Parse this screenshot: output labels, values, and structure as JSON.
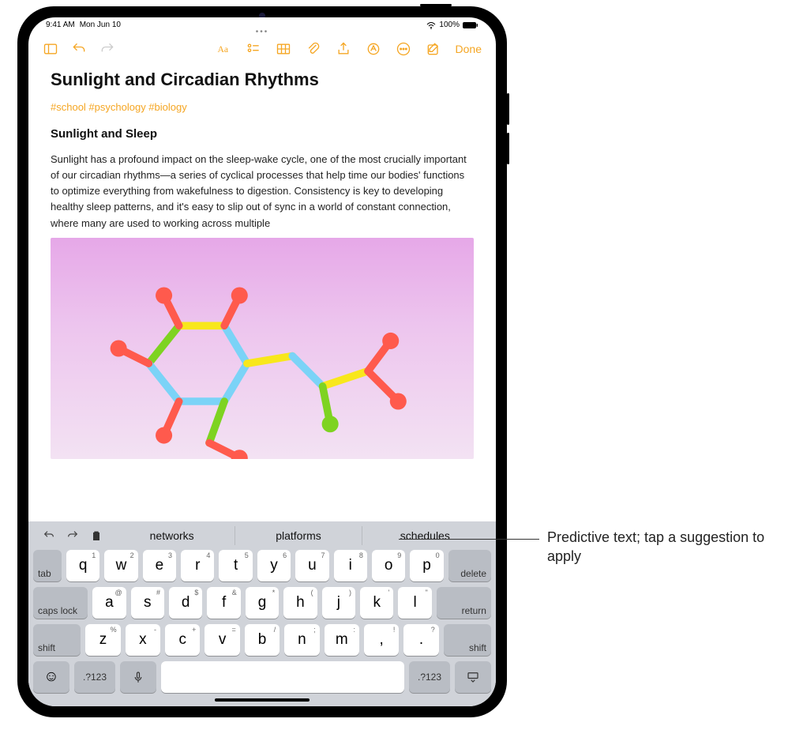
{
  "status": {
    "time": "9:41 AM",
    "date": "Mon Jun 10",
    "battery": "100%"
  },
  "toolbar": {
    "done": "Done"
  },
  "note": {
    "title": "Sunlight and Circadian Rhythms",
    "tags": "#school #psychology #biology",
    "section": "Sunlight and Sleep",
    "body": "Sunlight has a profound impact on the sleep-wake cycle, one of the most crucially important of our circadian rhythms—a series of cyclical processes that help time our bodies' functions to optimize everything from wakefulness to digestion. Consistency is key to developing healthy sleep patterns, and it's easy to slip out of sync in a world of constant connection, where many are used to working across multiple"
  },
  "keyboard": {
    "suggestions": [
      "networks",
      "platforms",
      "schedules"
    ],
    "row1": [
      {
        "k": "q",
        "a": "1"
      },
      {
        "k": "w",
        "a": "2"
      },
      {
        "k": "e",
        "a": "3"
      },
      {
        "k": "r",
        "a": "4"
      },
      {
        "k": "t",
        "a": "5"
      },
      {
        "k": "y",
        "a": "6"
      },
      {
        "k": "u",
        "a": "7"
      },
      {
        "k": "i",
        "a": "8"
      },
      {
        "k": "o",
        "a": "9"
      },
      {
        "k": "p",
        "a": "0"
      }
    ],
    "row2": [
      {
        "k": "a",
        "a": "@"
      },
      {
        "k": "s",
        "a": "#"
      },
      {
        "k": "d",
        "a": "$"
      },
      {
        "k": "f",
        "a": "&"
      },
      {
        "k": "g",
        "a": "*"
      },
      {
        "k": "h",
        "a": "("
      },
      {
        "k": "j",
        "a": ")"
      },
      {
        "k": "k",
        "a": "'"
      },
      {
        "k": "l",
        "a": "\""
      }
    ],
    "row3": [
      {
        "k": "z",
        "a": "%"
      },
      {
        "k": "x",
        "a": "-"
      },
      {
        "k": "c",
        "a": "+"
      },
      {
        "k": "v",
        "a": "="
      },
      {
        "k": "b",
        "a": "/"
      },
      {
        "k": "n",
        "a": ";"
      },
      {
        "k": "m",
        "a": ":"
      },
      {
        "k": ",",
        "a": "!"
      },
      {
        "k": ".",
        "a": "?"
      }
    ],
    "tab": "tab",
    "delete": "delete",
    "caps": "caps lock",
    "return": "return",
    "shift": "shift",
    "numsym": ".?123"
  },
  "callout": {
    "text": "Predictive text; tap a suggestion to apply"
  }
}
